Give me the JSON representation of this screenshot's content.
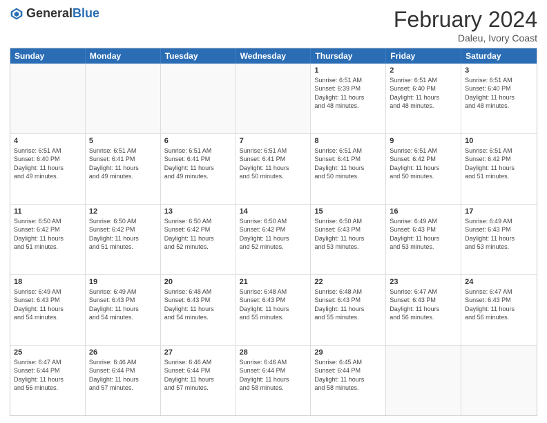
{
  "header": {
    "logo_general": "General",
    "logo_blue": "Blue",
    "month_year": "February 2024",
    "location": "Daleu, Ivory Coast"
  },
  "days_of_week": [
    "Sunday",
    "Monday",
    "Tuesday",
    "Wednesday",
    "Thursday",
    "Friday",
    "Saturday"
  ],
  "weeks": [
    [
      {
        "day": "",
        "info": ""
      },
      {
        "day": "",
        "info": ""
      },
      {
        "day": "",
        "info": ""
      },
      {
        "day": "",
        "info": ""
      },
      {
        "day": "1",
        "info": "Sunrise: 6:51 AM\nSunset: 6:39 PM\nDaylight: 11 hours\nand 48 minutes."
      },
      {
        "day": "2",
        "info": "Sunrise: 6:51 AM\nSunset: 6:40 PM\nDaylight: 11 hours\nand 48 minutes."
      },
      {
        "day": "3",
        "info": "Sunrise: 6:51 AM\nSunset: 6:40 PM\nDaylight: 11 hours\nand 48 minutes."
      }
    ],
    [
      {
        "day": "4",
        "info": "Sunrise: 6:51 AM\nSunset: 6:40 PM\nDaylight: 11 hours\nand 49 minutes."
      },
      {
        "day": "5",
        "info": "Sunrise: 6:51 AM\nSunset: 6:41 PM\nDaylight: 11 hours\nand 49 minutes."
      },
      {
        "day": "6",
        "info": "Sunrise: 6:51 AM\nSunset: 6:41 PM\nDaylight: 11 hours\nand 49 minutes."
      },
      {
        "day": "7",
        "info": "Sunrise: 6:51 AM\nSunset: 6:41 PM\nDaylight: 11 hours\nand 50 minutes."
      },
      {
        "day": "8",
        "info": "Sunrise: 6:51 AM\nSunset: 6:41 PM\nDaylight: 11 hours\nand 50 minutes."
      },
      {
        "day": "9",
        "info": "Sunrise: 6:51 AM\nSunset: 6:42 PM\nDaylight: 11 hours\nand 50 minutes."
      },
      {
        "day": "10",
        "info": "Sunrise: 6:51 AM\nSunset: 6:42 PM\nDaylight: 11 hours\nand 51 minutes."
      }
    ],
    [
      {
        "day": "11",
        "info": "Sunrise: 6:50 AM\nSunset: 6:42 PM\nDaylight: 11 hours\nand 51 minutes."
      },
      {
        "day": "12",
        "info": "Sunrise: 6:50 AM\nSunset: 6:42 PM\nDaylight: 11 hours\nand 51 minutes."
      },
      {
        "day": "13",
        "info": "Sunrise: 6:50 AM\nSunset: 6:42 PM\nDaylight: 11 hours\nand 52 minutes."
      },
      {
        "day": "14",
        "info": "Sunrise: 6:50 AM\nSunset: 6:42 PM\nDaylight: 11 hours\nand 52 minutes."
      },
      {
        "day": "15",
        "info": "Sunrise: 6:50 AM\nSunset: 6:43 PM\nDaylight: 11 hours\nand 53 minutes."
      },
      {
        "day": "16",
        "info": "Sunrise: 6:49 AM\nSunset: 6:43 PM\nDaylight: 11 hours\nand 53 minutes."
      },
      {
        "day": "17",
        "info": "Sunrise: 6:49 AM\nSunset: 6:43 PM\nDaylight: 11 hours\nand 53 minutes."
      }
    ],
    [
      {
        "day": "18",
        "info": "Sunrise: 6:49 AM\nSunset: 6:43 PM\nDaylight: 11 hours\nand 54 minutes."
      },
      {
        "day": "19",
        "info": "Sunrise: 6:49 AM\nSunset: 6:43 PM\nDaylight: 11 hours\nand 54 minutes."
      },
      {
        "day": "20",
        "info": "Sunrise: 6:48 AM\nSunset: 6:43 PM\nDaylight: 11 hours\nand 54 minutes."
      },
      {
        "day": "21",
        "info": "Sunrise: 6:48 AM\nSunset: 6:43 PM\nDaylight: 11 hours\nand 55 minutes."
      },
      {
        "day": "22",
        "info": "Sunrise: 6:48 AM\nSunset: 6:43 PM\nDaylight: 11 hours\nand 55 minutes."
      },
      {
        "day": "23",
        "info": "Sunrise: 6:47 AM\nSunset: 6:43 PM\nDaylight: 11 hours\nand 56 minutes."
      },
      {
        "day": "24",
        "info": "Sunrise: 6:47 AM\nSunset: 6:43 PM\nDaylight: 11 hours\nand 56 minutes."
      }
    ],
    [
      {
        "day": "25",
        "info": "Sunrise: 6:47 AM\nSunset: 6:44 PM\nDaylight: 11 hours\nand 56 minutes."
      },
      {
        "day": "26",
        "info": "Sunrise: 6:46 AM\nSunset: 6:44 PM\nDaylight: 11 hours\nand 57 minutes."
      },
      {
        "day": "27",
        "info": "Sunrise: 6:46 AM\nSunset: 6:44 PM\nDaylight: 11 hours\nand 57 minutes."
      },
      {
        "day": "28",
        "info": "Sunrise: 6:46 AM\nSunset: 6:44 PM\nDaylight: 11 hours\nand 58 minutes."
      },
      {
        "day": "29",
        "info": "Sunrise: 6:45 AM\nSunset: 6:44 PM\nDaylight: 11 hours\nand 58 minutes."
      },
      {
        "day": "",
        "info": ""
      },
      {
        "day": "",
        "info": ""
      }
    ]
  ]
}
